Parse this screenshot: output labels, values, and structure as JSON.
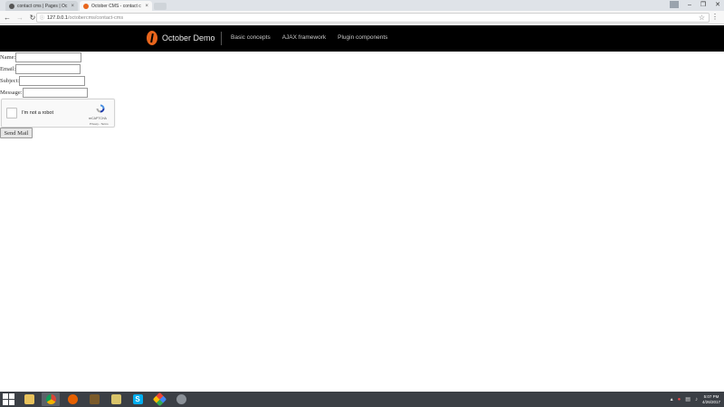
{
  "browser": {
    "tabs": [
      {
        "title": "contact cms | Pages | Oc",
        "active": false
      },
      {
        "title": "October CMS - contact c",
        "active": true
      }
    ],
    "close_glyph": "×",
    "address_host": "127.0.0.1",
    "address_path": "/octobercms/contact-cms"
  },
  "site": {
    "brand": "October Demo",
    "nav": [
      "Basic concepts",
      "AJAX framework",
      "Plugin components"
    ],
    "colors": {
      "navbar_bg": "#000000",
      "logo": "#e8651c"
    }
  },
  "form": {
    "name_label": "Name:",
    "email_label": "Email:",
    "subject_label": "Subject:",
    "message_label": "Message:",
    "recaptcha_label": "I'm not a robot",
    "recaptcha_brand": "reCAPTCHA",
    "recaptcha_links": "Privacy - Terms",
    "submit_label": "Send Mail"
  },
  "taskbar": {
    "icons": [
      "start-icon",
      "file-explorer-icon",
      "chrome-icon",
      "firefox-icon",
      "media-app-icon",
      "folder-icon",
      "skype-icon",
      "android-app-icon",
      "settings-app-icon"
    ],
    "skype_letter": "S",
    "time": "5:07 PM",
    "date": "4/26/2017"
  }
}
